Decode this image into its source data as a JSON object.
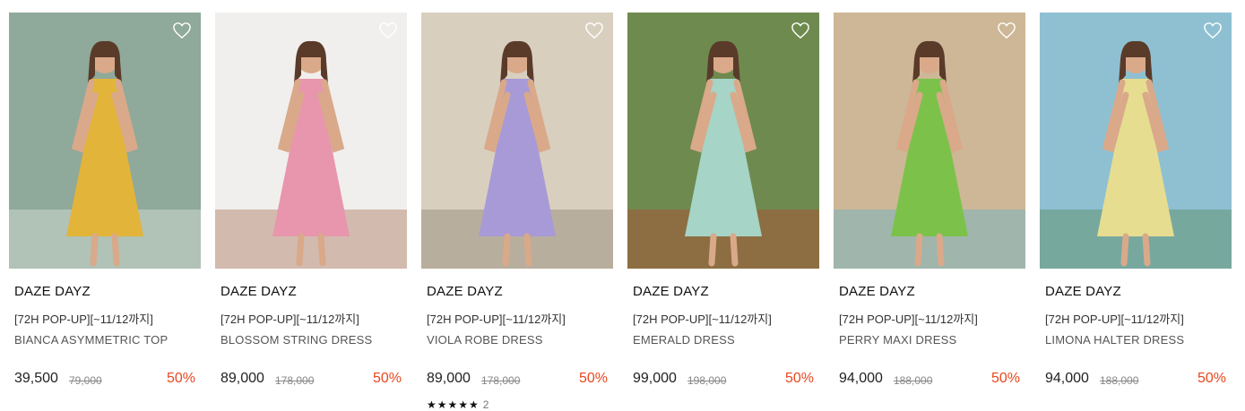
{
  "products": [
    {
      "brand": "DAZE DAYZ",
      "promo": "[72H POP-UP][~11/12까지]",
      "name": "BIANCA ASYMMETRIC TOP",
      "price": "39,500",
      "original": "79,000",
      "discount": "50%",
      "colors": {
        "bg": "#8fa99a",
        "fg": "#e2b43a",
        "accent": "#f0f0ea"
      }
    },
    {
      "brand": "DAZE DAYZ",
      "promo": "[72H POP-UP][~11/12까지]",
      "name": "BLOSSOM STRING DRESS",
      "price": "89,000",
      "original": "178,000",
      "discount": "50%",
      "colors": {
        "bg": "#f1efed",
        "fg": "#e796ad",
        "accent": "#9a5a3a"
      }
    },
    {
      "brand": "DAZE DAYZ",
      "promo": "[72H POP-UP][~11/12까지]",
      "name": "VIOLA ROBE DRESS",
      "price": "89,000",
      "original": "178,000",
      "discount": "50%",
      "rating": {
        "stars": "★★★★★",
        "count": "2"
      },
      "colors": {
        "bg": "#d9cfbf",
        "fg": "#a79ad6",
        "accent": "#7a705f"
      }
    },
    {
      "brand": "DAZE DAYZ",
      "promo": "[72H POP-UP][~11/12까지]",
      "name": "EMERALD DRESS",
      "price": "99,000",
      "original": "198,000",
      "discount": "50%",
      "colors": {
        "bg": "#6e8a4e",
        "fg": "#a6d4c6",
        "accent": "#c83a2e"
      }
    },
    {
      "brand": "DAZE DAYZ",
      "promo": "[72H POP-UP][~11/12까지]",
      "name": "PERRY MAXI DRESS",
      "price": "94,000",
      "original": "188,000",
      "discount": "50%",
      "colors": {
        "bg": "#cdb796",
        "fg": "#7cc24a",
        "accent": "#4cb3d8"
      }
    },
    {
      "brand": "DAZE DAYZ",
      "promo": "[72H POP-UP][~11/12까지]",
      "name": "LIMONA HALTER DRESS",
      "price": "94,000",
      "original": "188,000",
      "discount": "50%",
      "colors": {
        "bg": "#8ec0d2",
        "fg": "#e6dd90",
        "accent": "#4e7a3e"
      }
    }
  ],
  "icons": {
    "wishlist": "heart-outline-icon"
  },
  "theme": {
    "discount_color": "#e8471f"
  }
}
